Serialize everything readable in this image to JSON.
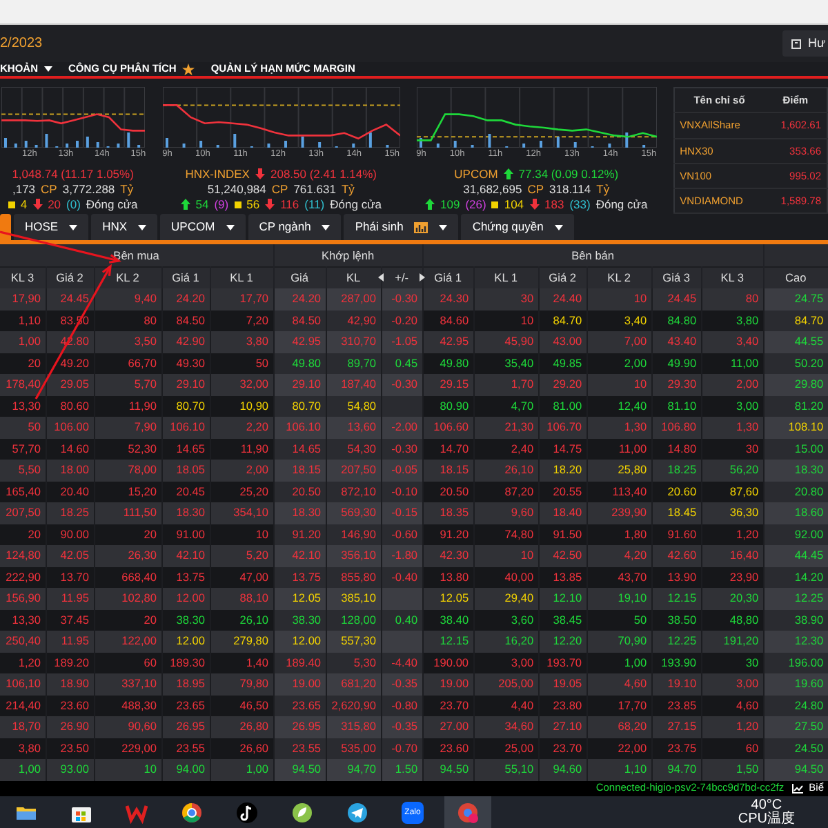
{
  "header": {
    "date": "2/2023",
    "user_button": "Hư"
  },
  "menu": [
    {
      "label": "KHOẢN",
      "kind": "dropdown"
    },
    {
      "label": "CÔNG CỤ PHÂN TÍCH",
      "kind": "starred"
    },
    {
      "label": "QUẢN LÝ HẠN MỨC MARGIN",
      "kind": "plain"
    }
  ],
  "indices": [
    {
      "time_labels": [
        "12h",
        "13h",
        "14h",
        "15h"
      ],
      "color": "#f0323c",
      "arrow": false,
      "value": "1,048.74",
      "change": "(11.17 1.05%)",
      "volume": ",173",
      "volume_unit": "CP",
      "traded": "3,772.288",
      "traded_unit": "Tỷ",
      "breadth": [
        {
          "kind": "ref",
          "text": "4"
        },
        {
          "kind": "down",
          "text": "20"
        },
        {
          "kind": "paren_down",
          "text": "(0)"
        }
      ],
      "status": "Đóng cửa"
    },
    {
      "time_labels": [
        "9h",
        "10h",
        "11h",
        "12h",
        "13h",
        "14h",
        "15h"
      ],
      "name": "HNX-INDEX",
      "color": "#f0323c",
      "arrow": true,
      "value": "208.50",
      "change": "(2.41 1.14%)",
      "volume": "51,240,984",
      "volume_unit": "CP",
      "traded": "761.631",
      "traded_unit": "Tỷ",
      "breadth": [
        {
          "kind": "up",
          "text": "54"
        },
        {
          "kind": "paren_up",
          "text": "(9)"
        },
        {
          "kind": "ref",
          "text": "56"
        },
        {
          "kind": "down",
          "text": "116"
        },
        {
          "kind": "paren_down",
          "text": "(11)"
        }
      ],
      "status": "Đóng cửa"
    },
    {
      "time_labels": [
        "9h",
        "10h",
        "11h",
        "12h",
        "13h",
        "14h",
        "15h"
      ],
      "name": "UPCOM",
      "color": "#1ed83a",
      "arrow": true,
      "value": "77.34",
      "change": "(0.09 0.12%)",
      "volume": "31,682,695",
      "volume_unit": "CP",
      "traded": "318.114",
      "traded_unit": "Tỷ",
      "breadth": [
        {
          "kind": "up",
          "text": "109"
        },
        {
          "kind": "paren_up",
          "text": "(26)"
        },
        {
          "kind": "ref",
          "text": "104"
        },
        {
          "kind": "down",
          "text": "183"
        },
        {
          "kind": "paren_down",
          "text": "(33)"
        }
      ],
      "status": "Đóng cửa"
    }
  ],
  "index_table": {
    "columns": [
      "Tên chỉ số",
      "Điểm"
    ],
    "rows": [
      {
        "name": "VNXAllShare",
        "points": "1,602.61",
        "color": "#f0323c"
      },
      {
        "name": "HNX30",
        "points": "353.66",
        "color": "#f0323c"
      },
      {
        "name": "VN100",
        "points": "995.02",
        "color": "#f0323c"
      },
      {
        "name": "VNDIAMOND",
        "points": "1,589.78",
        "color": "#f0323c"
      }
    ]
  },
  "tabs": [
    {
      "kind": "stub",
      "selected": true
    },
    {
      "label": "HOSE",
      "kind": "dropdown",
      "selected": false
    },
    {
      "label": "HNX",
      "kind": "dropdown",
      "selected": false
    },
    {
      "label": "UPCOM",
      "kind": "dropdown",
      "selected": false
    },
    {
      "label": "CP ngành",
      "kind": "dropdown",
      "selected": false
    },
    {
      "label": "Phái sinh",
      "kind": "chart-dropdown",
      "selected": false
    },
    {
      "label": "Chứng quyền",
      "kind": "dropdown",
      "selected": false
    }
  ],
  "table": {
    "groups": [
      {
        "label": "Bên mua",
        "columns": [
          "KL 3",
          "Giá 2",
          "KL 2",
          "Giá 1",
          "KL 1"
        ]
      },
      {
        "label": "Khớp lệnh",
        "columns": [
          "Giá",
          "KL",
          "+/-"
        ]
      },
      {
        "label": "Bên bán",
        "columns": [
          "Giá 1",
          "KL 1",
          "Giá 2",
          "KL 2",
          "Giá 3",
          "KL 3"
        ]
      },
      {
        "columns": [
          "Cao"
        ]
      }
    ],
    "rows": [
      {
        "cells": [
          {
            "text": "17,90",
            "color": "#f0323c"
          },
          {
            "text": "24.45",
            "color": "#f0323c"
          },
          {
            "text": "9,40",
            "color": "#f0323c"
          },
          {
            "text": "24.20",
            "color": "#f0323c"
          },
          {
            "text": "17,70",
            "color": "#f0323c"
          },
          {
            "text": "24.20",
            "color": "#f0323c"
          },
          {
            "text": "287,00",
            "color": "#f0323c"
          },
          {
            "text": "-0.30",
            "color": "#f0323c"
          },
          {
            "text": "24.30",
            "color": "#f0323c"
          },
          {
            "text": "30",
            "color": "#f0323c"
          },
          {
            "text": "24.40",
            "color": "#f0323c"
          },
          {
            "text": "10",
            "color": "#f0323c"
          },
          {
            "text": "24.45",
            "color": "#f0323c"
          },
          {
            "text": "80",
            "color": "#f0323c"
          },
          {
            "text": "24.75",
            "color": "#1ed83a"
          }
        ]
      },
      {
        "cells": [
          {
            "text": "1,10",
            "color": "#f0323c"
          },
          {
            "text": "83.50",
            "color": "#f0323c"
          },
          {
            "text": "80",
            "color": "#f0323c"
          },
          {
            "text": "84.50",
            "color": "#f0323c"
          },
          {
            "text": "7,20",
            "color": "#f0323c"
          },
          {
            "text": "84.50",
            "color": "#f0323c"
          },
          {
            "text": "42,90",
            "color": "#f0323c"
          },
          {
            "text": "-0.20",
            "color": "#f0323c"
          },
          {
            "text": "84.60",
            "color": "#f0323c"
          },
          {
            "text": "10",
            "color": "#f0323c"
          },
          {
            "text": "84.70",
            "color": "#f2d200"
          },
          {
            "text": "3,40",
            "color": "#f2d200"
          },
          {
            "text": "84.80",
            "color": "#1ed83a"
          },
          {
            "text": "3,80",
            "color": "#1ed83a"
          },
          {
            "text": "84.70",
            "color": "#f2d200"
          }
        ]
      },
      {
        "cells": [
          {
            "text": "1,00",
            "color": "#f0323c"
          },
          {
            "text": "42.80",
            "color": "#f0323c"
          },
          {
            "text": "3,50",
            "color": "#f0323c"
          },
          {
            "text": "42.90",
            "color": "#f0323c"
          },
          {
            "text": "3,80",
            "color": "#f0323c"
          },
          {
            "text": "42.95",
            "color": "#f0323c"
          },
          {
            "text": "310,70",
            "color": "#f0323c"
          },
          {
            "text": "-1.05",
            "color": "#f0323c"
          },
          {
            "text": "42.95",
            "color": "#f0323c"
          },
          {
            "text": "45,90",
            "color": "#f0323c"
          },
          {
            "text": "43.00",
            "color": "#f0323c"
          },
          {
            "text": "7,00",
            "color": "#f0323c"
          },
          {
            "text": "43.40",
            "color": "#f0323c"
          },
          {
            "text": "3,40",
            "color": "#f0323c"
          },
          {
            "text": "44.55",
            "color": "#1ed83a"
          }
        ]
      },
      {
        "cells": [
          {
            "text": "20",
            "color": "#f0323c"
          },
          {
            "text": "49.20",
            "color": "#f0323c"
          },
          {
            "text": "66,70",
            "color": "#f0323c"
          },
          {
            "text": "49.30",
            "color": "#f0323c"
          },
          {
            "text": "50",
            "color": "#f0323c"
          },
          {
            "text": "49.80",
            "color": "#1ed83a"
          },
          {
            "text": "89,70",
            "color": "#1ed83a"
          },
          {
            "text": "0.45",
            "color": "#1ed83a"
          },
          {
            "text": "49.80",
            "color": "#1ed83a"
          },
          {
            "text": "35,40",
            "color": "#1ed83a"
          },
          {
            "text": "49.85",
            "color": "#1ed83a"
          },
          {
            "text": "2,00",
            "color": "#1ed83a"
          },
          {
            "text": "49.90",
            "color": "#1ed83a"
          },
          {
            "text": "11,00",
            "color": "#1ed83a"
          },
          {
            "text": "50.20",
            "color": "#1ed83a"
          }
        ]
      },
      {
        "cells": [
          {
            "text": "178,40",
            "color": "#f0323c"
          },
          {
            "text": "29.05",
            "color": "#f0323c"
          },
          {
            "text": "5,70",
            "color": "#f0323c"
          },
          {
            "text": "29.10",
            "color": "#f0323c"
          },
          {
            "text": "32,00",
            "color": "#f0323c"
          },
          {
            "text": "29.10",
            "color": "#f0323c"
          },
          {
            "text": "187,40",
            "color": "#f0323c"
          },
          {
            "text": "-0.30",
            "color": "#f0323c"
          },
          {
            "text": "29.15",
            "color": "#f0323c"
          },
          {
            "text": "1,70",
            "color": "#f0323c"
          },
          {
            "text": "29.20",
            "color": "#f0323c"
          },
          {
            "text": "10",
            "color": "#f0323c"
          },
          {
            "text": "29.30",
            "color": "#f0323c"
          },
          {
            "text": "2,00",
            "color": "#f0323c"
          },
          {
            "text": "29.80",
            "color": "#1ed83a"
          }
        ]
      },
      {
        "cells": [
          {
            "text": "13,30",
            "color": "#f0323c"
          },
          {
            "text": "80.60",
            "color": "#f0323c"
          },
          {
            "text": "11,90",
            "color": "#f0323c"
          },
          {
            "text": "80.70",
            "color": "#f2d200"
          },
          {
            "text": "10,90",
            "color": "#f2d200"
          },
          {
            "text": "80.70",
            "color": "#f2d200"
          },
          {
            "text": "54,80",
            "color": "#f2d200"
          },
          null,
          {
            "text": "80.90",
            "color": "#1ed83a"
          },
          {
            "text": "4,70",
            "color": "#1ed83a"
          },
          {
            "text": "81.00",
            "color": "#1ed83a"
          },
          {
            "text": "12,40",
            "color": "#1ed83a"
          },
          {
            "text": "81.10",
            "color": "#1ed83a"
          },
          {
            "text": "3,00",
            "color": "#1ed83a"
          },
          {
            "text": "81.20",
            "color": "#1ed83a"
          }
        ]
      },
      {
        "cells": [
          {
            "text": "50",
            "color": "#f0323c"
          },
          {
            "text": "106.00",
            "color": "#f0323c"
          },
          {
            "text": "7,90",
            "color": "#f0323c"
          },
          {
            "text": "106.10",
            "color": "#f0323c"
          },
          {
            "text": "2,20",
            "color": "#f0323c"
          },
          {
            "text": "106.10",
            "color": "#f0323c"
          },
          {
            "text": "13,60",
            "color": "#f0323c"
          },
          {
            "text": "-2.00",
            "color": "#f0323c"
          },
          {
            "text": "106.60",
            "color": "#f0323c"
          },
          {
            "text": "21,30",
            "color": "#f0323c"
          },
          {
            "text": "106.70",
            "color": "#f0323c"
          },
          {
            "text": "1,30",
            "color": "#f0323c"
          },
          {
            "text": "106.80",
            "color": "#f0323c"
          },
          {
            "text": "1,30",
            "color": "#f0323c"
          },
          {
            "text": "108.10",
            "color": "#f2d200"
          }
        ]
      },
      {
        "cells": [
          {
            "text": "57,70",
            "color": "#f0323c"
          },
          {
            "text": "14.60",
            "color": "#f0323c"
          },
          {
            "text": "52,30",
            "color": "#f0323c"
          },
          {
            "text": "14.65",
            "color": "#f0323c"
          },
          {
            "text": "11,90",
            "color": "#f0323c"
          },
          {
            "text": "14.65",
            "color": "#f0323c"
          },
          {
            "text": "54,30",
            "color": "#f0323c"
          },
          {
            "text": "-0.30",
            "color": "#f0323c"
          },
          {
            "text": "14.70",
            "color": "#f0323c"
          },
          {
            "text": "2,40",
            "color": "#f0323c"
          },
          {
            "text": "14.75",
            "color": "#f0323c"
          },
          {
            "text": "11,00",
            "color": "#f0323c"
          },
          {
            "text": "14.80",
            "color": "#f0323c"
          },
          {
            "text": "30",
            "color": "#f0323c"
          },
          {
            "text": "15.00",
            "color": "#1ed83a"
          }
        ]
      },
      {
        "cells": [
          {
            "text": "5,50",
            "color": "#f0323c"
          },
          {
            "text": "18.00",
            "color": "#f0323c"
          },
          {
            "text": "78,00",
            "color": "#f0323c"
          },
          {
            "text": "18.05",
            "color": "#f0323c"
          },
          {
            "text": "2,00",
            "color": "#f0323c"
          },
          {
            "text": "18.15",
            "color": "#f0323c"
          },
          {
            "text": "207,50",
            "color": "#f0323c"
          },
          {
            "text": "-0.05",
            "color": "#f0323c"
          },
          {
            "text": "18.15",
            "color": "#f0323c"
          },
          {
            "text": "26,10",
            "color": "#f0323c"
          },
          {
            "text": "18.20",
            "color": "#f2d200"
          },
          {
            "text": "25,80",
            "color": "#f2d200"
          },
          {
            "text": "18.25",
            "color": "#1ed83a"
          },
          {
            "text": "56,20",
            "color": "#1ed83a"
          },
          {
            "text": "18.30",
            "color": "#1ed83a"
          }
        ]
      },
      {
        "cells": [
          {
            "text": "165,40",
            "color": "#f0323c"
          },
          {
            "text": "20.40",
            "color": "#f0323c"
          },
          {
            "text": "15,20",
            "color": "#f0323c"
          },
          {
            "text": "20.45",
            "color": "#f0323c"
          },
          {
            "text": "25,20",
            "color": "#f0323c"
          },
          {
            "text": "20.50",
            "color": "#f0323c"
          },
          {
            "text": "872,10",
            "color": "#f0323c"
          },
          {
            "text": "-0.10",
            "color": "#f0323c"
          },
          {
            "text": "20.50",
            "color": "#f0323c"
          },
          {
            "text": "87,20",
            "color": "#f0323c"
          },
          {
            "text": "20.55",
            "color": "#f0323c"
          },
          {
            "text": "113,40",
            "color": "#f0323c"
          },
          {
            "text": "20.60",
            "color": "#f2d200"
          },
          {
            "text": "87,60",
            "color": "#f2d200"
          },
          {
            "text": "20.80",
            "color": "#1ed83a"
          }
        ]
      },
      {
        "cells": [
          {
            "text": "207,50",
            "color": "#f0323c"
          },
          {
            "text": "18.25",
            "color": "#f0323c"
          },
          {
            "text": "111,50",
            "color": "#f0323c"
          },
          {
            "text": "18.30",
            "color": "#f0323c"
          },
          {
            "text": "354,10",
            "color": "#f0323c"
          },
          {
            "text": "18.30",
            "color": "#f0323c"
          },
          {
            "text": "569,30",
            "color": "#f0323c"
          },
          {
            "text": "-0.15",
            "color": "#f0323c"
          },
          {
            "text": "18.35",
            "color": "#f0323c"
          },
          {
            "text": "9,60",
            "color": "#f0323c"
          },
          {
            "text": "18.40",
            "color": "#f0323c"
          },
          {
            "text": "239,90",
            "color": "#f0323c"
          },
          {
            "text": "18.45",
            "color": "#f2d200"
          },
          {
            "text": "36,30",
            "color": "#f2d200"
          },
          {
            "text": "18.60",
            "color": "#1ed83a"
          }
        ]
      },
      {
        "cells": [
          {
            "text": "20",
            "color": "#f0323c"
          },
          {
            "text": "90.00",
            "color": "#f0323c"
          },
          {
            "text": "20",
            "color": "#f0323c"
          },
          {
            "text": "91.00",
            "color": "#f0323c"
          },
          {
            "text": "10",
            "color": "#f0323c"
          },
          {
            "text": "91.20",
            "color": "#f0323c"
          },
          {
            "text": "146,90",
            "color": "#f0323c"
          },
          {
            "text": "-0.60",
            "color": "#f0323c"
          },
          {
            "text": "91.20",
            "color": "#f0323c"
          },
          {
            "text": "74,80",
            "color": "#f0323c"
          },
          {
            "text": "91.50",
            "color": "#f0323c"
          },
          {
            "text": "1,80",
            "color": "#f0323c"
          },
          {
            "text": "91.60",
            "color": "#f0323c"
          },
          {
            "text": "1,20",
            "color": "#f0323c"
          },
          {
            "text": "92.00",
            "color": "#1ed83a"
          }
        ]
      },
      {
        "cells": [
          {
            "text": "124,80",
            "color": "#f0323c"
          },
          {
            "text": "42.05",
            "color": "#f0323c"
          },
          {
            "text": "26,30",
            "color": "#f0323c"
          },
          {
            "text": "42.10",
            "color": "#f0323c"
          },
          {
            "text": "5,20",
            "color": "#f0323c"
          },
          {
            "text": "42.10",
            "color": "#f0323c"
          },
          {
            "text": "356,10",
            "color": "#f0323c"
          },
          {
            "text": "-1.80",
            "color": "#f0323c"
          },
          {
            "text": "42.30",
            "color": "#f0323c"
          },
          {
            "text": "10",
            "color": "#f0323c"
          },
          {
            "text": "42.50",
            "color": "#f0323c"
          },
          {
            "text": "4,20",
            "color": "#f0323c"
          },
          {
            "text": "42.60",
            "color": "#f0323c"
          },
          {
            "text": "16,40",
            "color": "#f0323c"
          },
          {
            "text": "44.45",
            "color": "#1ed83a"
          }
        ]
      },
      {
        "cells": [
          {
            "text": "222,90",
            "color": "#f0323c"
          },
          {
            "text": "13.70",
            "color": "#f0323c"
          },
          {
            "text": "668,40",
            "color": "#f0323c"
          },
          {
            "text": "13.75",
            "color": "#f0323c"
          },
          {
            "text": "47,00",
            "color": "#f0323c"
          },
          {
            "text": "13.75",
            "color": "#f0323c"
          },
          {
            "text": "855,80",
            "color": "#f0323c"
          },
          {
            "text": "-0.40",
            "color": "#f0323c"
          },
          {
            "text": "13.80",
            "color": "#f0323c"
          },
          {
            "text": "40,00",
            "color": "#f0323c"
          },
          {
            "text": "13.85",
            "color": "#f0323c"
          },
          {
            "text": "43,70",
            "color": "#f0323c"
          },
          {
            "text": "13.90",
            "color": "#f0323c"
          },
          {
            "text": "23,90",
            "color": "#f0323c"
          },
          {
            "text": "14.20",
            "color": "#1ed83a"
          }
        ]
      },
      {
        "cells": [
          {
            "text": "156,90",
            "color": "#f0323c"
          },
          {
            "text": "11.95",
            "color": "#f0323c"
          },
          {
            "text": "102,80",
            "color": "#f0323c"
          },
          {
            "text": "12.00",
            "color": "#f0323c"
          },
          {
            "text": "88,10",
            "color": "#f0323c"
          },
          {
            "text": "12.05",
            "color": "#f2d200"
          },
          {
            "text": "385,10",
            "color": "#f2d200"
          },
          null,
          {
            "text": "12.05",
            "color": "#f2d200"
          },
          {
            "text": "29,40",
            "color": "#f2d200"
          },
          {
            "text": "12.10",
            "color": "#1ed83a"
          },
          {
            "text": "19,10",
            "color": "#1ed83a"
          },
          {
            "text": "12.15",
            "color": "#1ed83a"
          },
          {
            "text": "20,30",
            "color": "#1ed83a"
          },
          {
            "text": "12.25",
            "color": "#1ed83a"
          }
        ]
      },
      {
        "cells": [
          {
            "text": "13,30",
            "color": "#f0323c"
          },
          {
            "text": "37.45",
            "color": "#f0323c"
          },
          {
            "text": "20",
            "color": "#f0323c"
          },
          {
            "text": "38.30",
            "color": "#1ed83a"
          },
          {
            "text": "26,10",
            "color": "#1ed83a"
          },
          {
            "text": "38.30",
            "color": "#1ed83a"
          },
          {
            "text": "128,00",
            "color": "#1ed83a"
          },
          {
            "text": "0.40",
            "color": "#1ed83a"
          },
          {
            "text": "38.40",
            "color": "#1ed83a"
          },
          {
            "text": "3,60",
            "color": "#1ed83a"
          },
          {
            "text": "38.45",
            "color": "#1ed83a"
          },
          {
            "text": "50",
            "color": "#1ed83a"
          },
          {
            "text": "38.50",
            "color": "#1ed83a"
          },
          {
            "text": "48,80",
            "color": "#1ed83a"
          },
          {
            "text": "38.90",
            "color": "#1ed83a"
          }
        ]
      },
      {
        "cells": [
          {
            "text": "250,40",
            "color": "#f0323c"
          },
          {
            "text": "11.95",
            "color": "#f0323c"
          },
          {
            "text": "122,00",
            "color": "#f0323c"
          },
          {
            "text": "12.00",
            "color": "#f2d200"
          },
          {
            "text": "279,80",
            "color": "#f2d200"
          },
          {
            "text": "12.00",
            "color": "#f2d200"
          },
          {
            "text": "557,30",
            "color": "#f2d200"
          },
          null,
          {
            "text": "12.15",
            "color": "#1ed83a"
          },
          {
            "text": "16,20",
            "color": "#1ed83a"
          },
          {
            "text": "12.20",
            "color": "#1ed83a"
          },
          {
            "text": "70,90",
            "color": "#1ed83a"
          },
          {
            "text": "12.25",
            "color": "#1ed83a"
          },
          {
            "text": "191,20",
            "color": "#1ed83a"
          },
          {
            "text": "12.30",
            "color": "#1ed83a"
          }
        ]
      },
      {
        "cells": [
          {
            "text": "1,20",
            "color": "#f0323c"
          },
          {
            "text": "189.20",
            "color": "#f0323c"
          },
          {
            "text": "60",
            "color": "#f0323c"
          },
          {
            "text": "189.30",
            "color": "#f0323c"
          },
          {
            "text": "1,40",
            "color": "#f0323c"
          },
          {
            "text": "189.40",
            "color": "#f0323c"
          },
          {
            "text": "5,30",
            "color": "#f0323c"
          },
          {
            "text": "-4.40",
            "color": "#f0323c"
          },
          {
            "text": "190.00",
            "color": "#f0323c"
          },
          {
            "text": "3,00",
            "color": "#f0323c"
          },
          {
            "text": "193.70",
            "color": "#f0323c"
          },
          {
            "text": "1,00",
            "color": "#1ed83a"
          },
          {
            "text": "193.90",
            "color": "#1ed83a"
          },
          {
            "text": "30",
            "color": "#1ed83a"
          },
          {
            "text": "196.00",
            "color": "#1ed83a"
          }
        ]
      },
      {
        "cells": [
          {
            "text": "106,10",
            "color": "#f0323c"
          },
          {
            "text": "18.90",
            "color": "#f0323c"
          },
          {
            "text": "337,10",
            "color": "#f0323c"
          },
          {
            "text": "18.95",
            "color": "#f0323c"
          },
          {
            "text": "79,80",
            "color": "#f0323c"
          },
          {
            "text": "19.00",
            "color": "#f0323c"
          },
          {
            "text": "681,20",
            "color": "#f0323c"
          },
          {
            "text": "-0.35",
            "color": "#f0323c"
          },
          {
            "text": "19.00",
            "color": "#f0323c"
          },
          {
            "text": "205,00",
            "color": "#f0323c"
          },
          {
            "text": "19.05",
            "color": "#f0323c"
          },
          {
            "text": "4,60",
            "color": "#f0323c"
          },
          {
            "text": "19.10",
            "color": "#f0323c"
          },
          {
            "text": "3,00",
            "color": "#f0323c"
          },
          {
            "text": "19.60",
            "color": "#1ed83a"
          }
        ]
      },
      {
        "cells": [
          {
            "text": "214,40",
            "color": "#f0323c"
          },
          {
            "text": "23.60",
            "color": "#f0323c"
          },
          {
            "text": "488,30",
            "color": "#f0323c"
          },
          {
            "text": "23.65",
            "color": "#f0323c"
          },
          {
            "text": "46,50",
            "color": "#f0323c"
          },
          {
            "text": "23.65",
            "color": "#f0323c"
          },
          {
            "text": "2,620,90",
            "color": "#f0323c"
          },
          {
            "text": "-0.80",
            "color": "#f0323c"
          },
          {
            "text": "23.70",
            "color": "#f0323c"
          },
          {
            "text": "4,40",
            "color": "#f0323c"
          },
          {
            "text": "23.80",
            "color": "#f0323c"
          },
          {
            "text": "17,70",
            "color": "#f0323c"
          },
          {
            "text": "23.85",
            "color": "#f0323c"
          },
          {
            "text": "4,60",
            "color": "#f0323c"
          },
          {
            "text": "24.80",
            "color": "#1ed83a"
          }
        ]
      },
      {
        "cells": [
          {
            "text": "18,70",
            "color": "#f0323c"
          },
          {
            "text": "26.90",
            "color": "#f0323c"
          },
          {
            "text": "90,60",
            "color": "#f0323c"
          },
          {
            "text": "26.95",
            "color": "#f0323c"
          },
          {
            "text": "26,80",
            "color": "#f0323c"
          },
          {
            "text": "26.95",
            "color": "#f0323c"
          },
          {
            "text": "315,80",
            "color": "#f0323c"
          },
          {
            "text": "-0.35",
            "color": "#f0323c"
          },
          {
            "text": "27.00",
            "color": "#f0323c"
          },
          {
            "text": "34,60",
            "color": "#f0323c"
          },
          {
            "text": "27.10",
            "color": "#f0323c"
          },
          {
            "text": "68,20",
            "color": "#f0323c"
          },
          {
            "text": "27.15",
            "color": "#f0323c"
          },
          {
            "text": "1,20",
            "color": "#f0323c"
          },
          {
            "text": "27.50",
            "color": "#1ed83a"
          }
        ]
      },
      {
        "cells": [
          {
            "text": "3,80",
            "color": "#f0323c"
          },
          {
            "text": "23.50",
            "color": "#f0323c"
          },
          {
            "text": "229,00",
            "color": "#f0323c"
          },
          {
            "text": "23.55",
            "color": "#f0323c"
          },
          {
            "text": "26,60",
            "color": "#f0323c"
          },
          {
            "text": "23.55",
            "color": "#f0323c"
          },
          {
            "text": "535,00",
            "color": "#f0323c"
          },
          {
            "text": "-0.70",
            "color": "#f0323c"
          },
          {
            "text": "23.60",
            "color": "#f0323c"
          },
          {
            "text": "25,00",
            "color": "#f0323c"
          },
          {
            "text": "23.70",
            "color": "#f0323c"
          },
          {
            "text": "22,00",
            "color": "#f0323c"
          },
          {
            "text": "23.75",
            "color": "#f0323c"
          },
          {
            "text": "60",
            "color": "#f0323c"
          },
          {
            "text": "24.50",
            "color": "#1ed83a"
          }
        ]
      },
      {
        "cells": [
          {
            "text": "1,00",
            "color": "#1ed83a"
          },
          {
            "text": "93.00",
            "color": "#1ed83a"
          },
          {
            "text": "10",
            "color": "#1ed83a"
          },
          {
            "text": "94.00",
            "color": "#1ed83a"
          },
          {
            "text": "1,00",
            "color": "#1ed83a"
          },
          {
            "text": "94.50",
            "color": "#1ed83a"
          },
          {
            "text": "94,70",
            "color": "#1ed83a"
          },
          {
            "text": "1.50",
            "color": "#1ed83a"
          },
          {
            "text": "94.50",
            "color": "#1ed83a"
          },
          {
            "text": "55,10",
            "color": "#1ed83a"
          },
          {
            "text": "94.60",
            "color": "#1ed83a"
          },
          {
            "text": "1,10",
            "color": "#1ed83a"
          },
          {
            "text": "94.70",
            "color": "#1ed83a"
          },
          {
            "text": "1,50",
            "color": "#1ed83a"
          },
          {
            "text": "94.50",
            "color": "#1ed83a"
          }
        ]
      }
    ]
  },
  "annotations": [
    {
      "kind": "arrow"
    },
    {
      "kind": "arrow"
    }
  ],
  "status_bar": {
    "connection": "Connected-higio-psv2-74bcc9d7bd-cc2fz",
    "chart_link": "Biể"
  },
  "taskbar": {
    "apps": [
      {
        "kind": "folder",
        "selected": false
      },
      {
        "kind": "store",
        "selected": false
      },
      {
        "kind": "office",
        "selected": false
      },
      {
        "kind": "browser",
        "selected": false
      },
      {
        "kind": "music",
        "selected": false
      },
      {
        "kind": "leaf",
        "selected": false
      },
      {
        "kind": "plane",
        "selected": false
      },
      {
        "kind": "chat",
        "label": "Zalo",
        "selected": false
      },
      {
        "kind": "profile",
        "selected": true
      }
    ],
    "temperature": "40°C",
    "sensor": "CPU温度"
  }
}
